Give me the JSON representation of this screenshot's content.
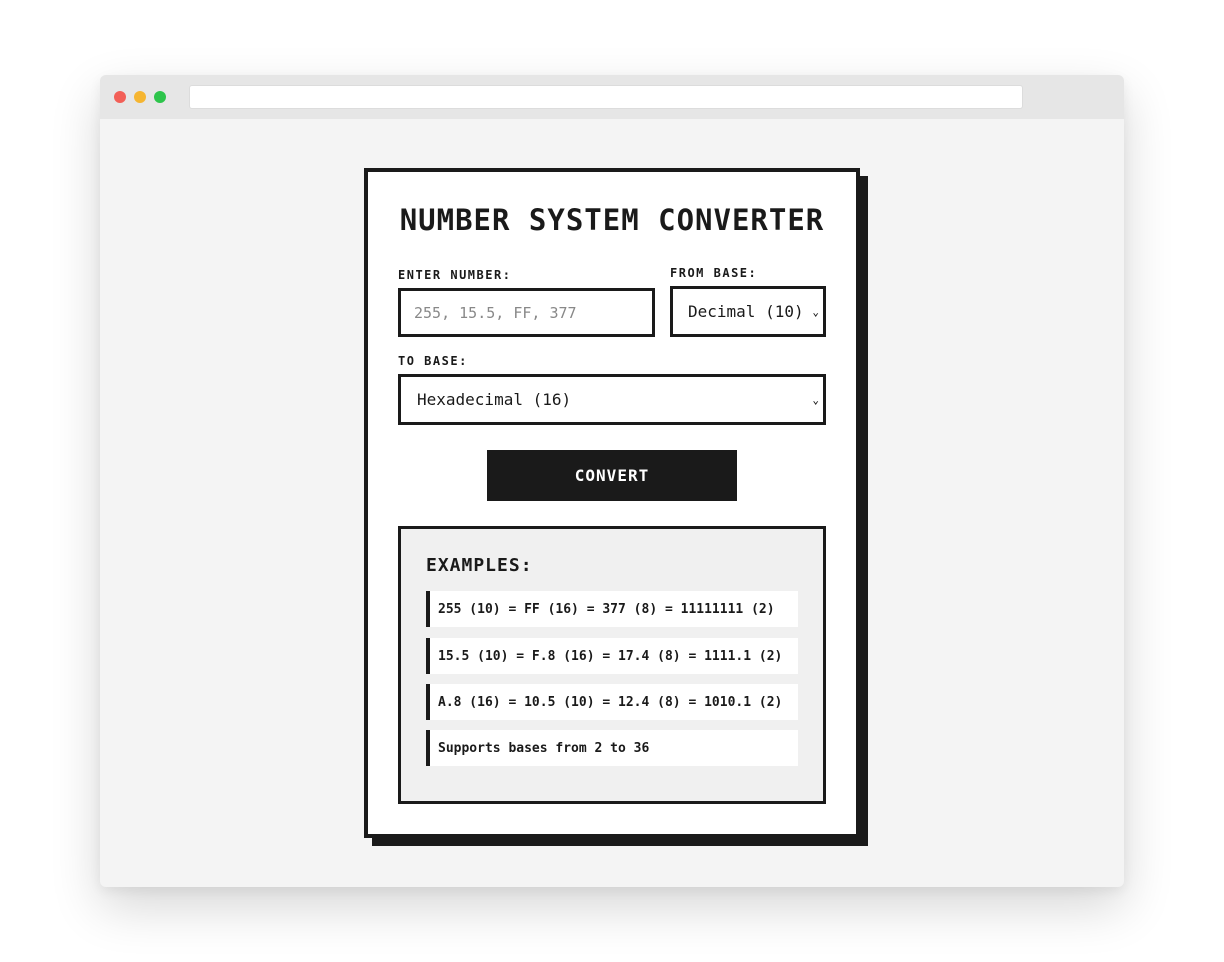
{
  "app": {
    "title": "NUMBER SYSTEM CONVERTER"
  },
  "form": {
    "number_label": "ENTER NUMBER:",
    "number_placeholder": "255, 15.5, FF, 377",
    "number_value": "",
    "from_label": "FROM BASE:",
    "from_selected": "Decimal (10)",
    "to_label": "TO BASE:",
    "to_selected": "Hexadecimal (16)",
    "convert_label": "CONVERT"
  },
  "examples": {
    "title": "EXAMPLES:",
    "items": [
      "255 (10) = FF (16) = 377 (8) = 11111111 (2)",
      "15.5 (10) = F.8 (16) = 17.4 (8) = 1111.1 (2)",
      "A.8 (16) = 10.5 (10) = 12.4 (8) = 1010.1 (2)",
      "Supports bases from 2 to 36"
    ]
  },
  "icons": {
    "dropdown": "chevron-down-icon"
  },
  "colors": {
    "ink": "#1a1a1a",
    "panel": "#f0f0f0",
    "page_bg": "#f4f4f4"
  }
}
